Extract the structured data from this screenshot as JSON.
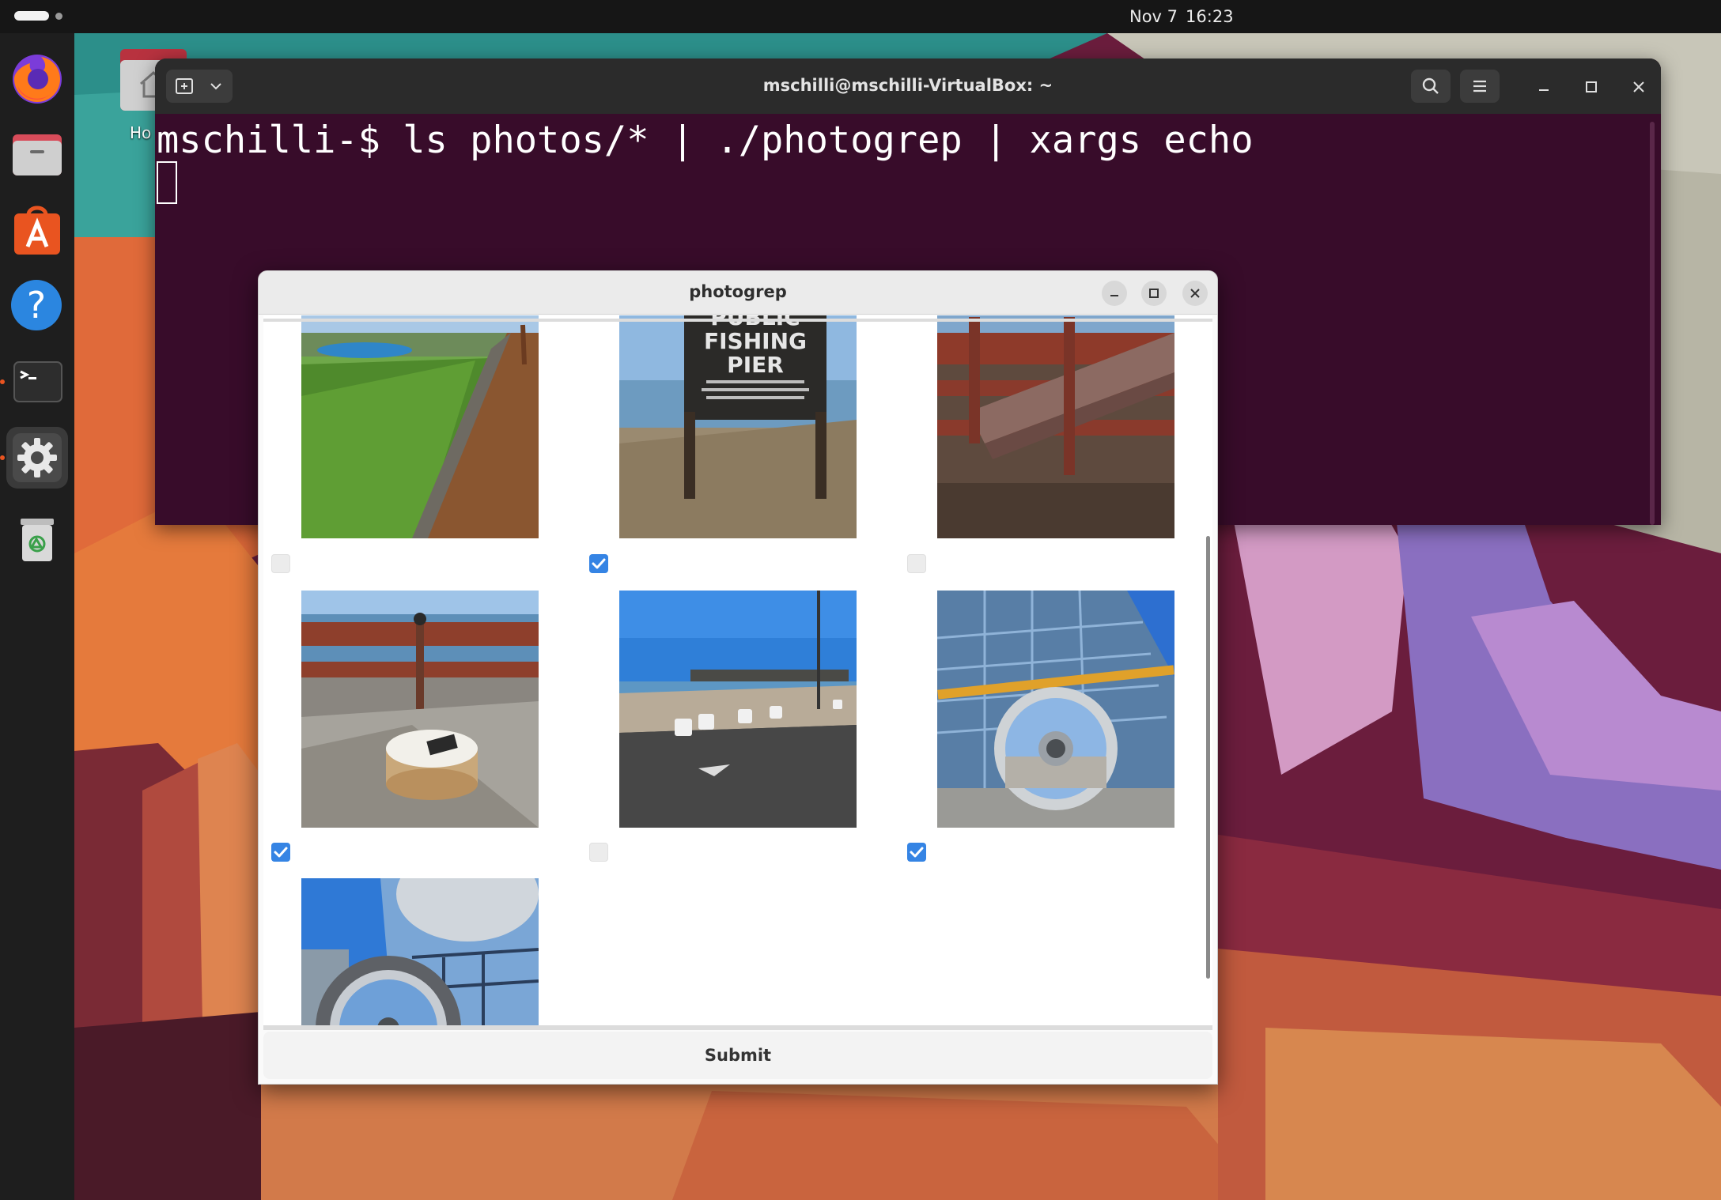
{
  "topbar": {
    "date": "Nov 7",
    "time": "16:23"
  },
  "dock": {
    "items": [
      "firefox-icon",
      "files-icon",
      "app-center-icon",
      "help-icon",
      "terminal-icon",
      "settings-icon",
      "trash-icon"
    ]
  },
  "desktop": {
    "home_label": "Ho"
  },
  "terminal": {
    "title": "mschilli@mschilli-VirtualBox: ~",
    "command_line": "mschilli-$ ls photos/* | ./photogrep | xargs echo"
  },
  "photogrep": {
    "title": "photogrep",
    "submit_label": "Submit",
    "photos": [
      {
        "subject": "grass-and-boardwalk",
        "checked": false
      },
      {
        "subject": "public-fishing-pier-sign",
        "checked": true
      },
      {
        "subject": "wooden-pier-railing",
        "checked": false
      },
      {
        "subject": "bait-container-on-pier",
        "checked": true
      },
      {
        "subject": "waterfront-plaza-bollards",
        "checked": false
      },
      {
        "subject": "arena-mirror-sculpture",
        "checked": true
      },
      {
        "subject": "glass-building-ring-sculpture",
        "checked": null
      }
    ],
    "sign_text": {
      "line1": "PUBLIC",
      "line2": "FISHING",
      "line3": "PIER"
    }
  },
  "colors": {
    "terminal_bg": "#380c2a",
    "checkbox_checked": "#3584e4",
    "accent": "#e95420"
  }
}
